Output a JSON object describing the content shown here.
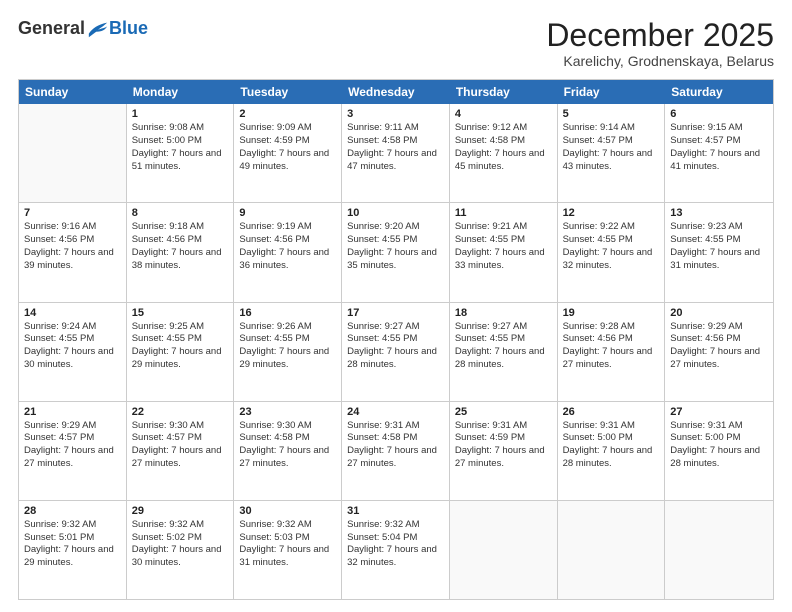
{
  "logo": {
    "general": "General",
    "blue": "Blue"
  },
  "header": {
    "month": "December 2025",
    "location": "Karelichy, Grodnenskaya, Belarus"
  },
  "days_of_week": [
    "Sunday",
    "Monday",
    "Tuesday",
    "Wednesday",
    "Thursday",
    "Friday",
    "Saturday"
  ],
  "weeks": [
    [
      {
        "day": "",
        "empty": true
      },
      {
        "day": "1",
        "sunrise": "Sunrise: 9:08 AM",
        "sunset": "Sunset: 5:00 PM",
        "daylight": "Daylight: 7 hours and 51 minutes."
      },
      {
        "day": "2",
        "sunrise": "Sunrise: 9:09 AM",
        "sunset": "Sunset: 4:59 PM",
        "daylight": "Daylight: 7 hours and 49 minutes."
      },
      {
        "day": "3",
        "sunrise": "Sunrise: 9:11 AM",
        "sunset": "Sunset: 4:58 PM",
        "daylight": "Daylight: 7 hours and 47 minutes."
      },
      {
        "day": "4",
        "sunrise": "Sunrise: 9:12 AM",
        "sunset": "Sunset: 4:58 PM",
        "daylight": "Daylight: 7 hours and 45 minutes."
      },
      {
        "day": "5",
        "sunrise": "Sunrise: 9:14 AM",
        "sunset": "Sunset: 4:57 PM",
        "daylight": "Daylight: 7 hours and 43 minutes."
      },
      {
        "day": "6",
        "sunrise": "Sunrise: 9:15 AM",
        "sunset": "Sunset: 4:57 PM",
        "daylight": "Daylight: 7 hours and 41 minutes."
      }
    ],
    [
      {
        "day": "7",
        "sunrise": "Sunrise: 9:16 AM",
        "sunset": "Sunset: 4:56 PM",
        "daylight": "Daylight: 7 hours and 39 minutes."
      },
      {
        "day": "8",
        "sunrise": "Sunrise: 9:18 AM",
        "sunset": "Sunset: 4:56 PM",
        "daylight": "Daylight: 7 hours and 38 minutes."
      },
      {
        "day": "9",
        "sunrise": "Sunrise: 9:19 AM",
        "sunset": "Sunset: 4:56 PM",
        "daylight": "Daylight: 7 hours and 36 minutes."
      },
      {
        "day": "10",
        "sunrise": "Sunrise: 9:20 AM",
        "sunset": "Sunset: 4:55 PM",
        "daylight": "Daylight: 7 hours and 35 minutes."
      },
      {
        "day": "11",
        "sunrise": "Sunrise: 9:21 AM",
        "sunset": "Sunset: 4:55 PM",
        "daylight": "Daylight: 7 hours and 33 minutes."
      },
      {
        "day": "12",
        "sunrise": "Sunrise: 9:22 AM",
        "sunset": "Sunset: 4:55 PM",
        "daylight": "Daylight: 7 hours and 32 minutes."
      },
      {
        "day": "13",
        "sunrise": "Sunrise: 9:23 AM",
        "sunset": "Sunset: 4:55 PM",
        "daylight": "Daylight: 7 hours and 31 minutes."
      }
    ],
    [
      {
        "day": "14",
        "sunrise": "Sunrise: 9:24 AM",
        "sunset": "Sunset: 4:55 PM",
        "daylight": "Daylight: 7 hours and 30 minutes."
      },
      {
        "day": "15",
        "sunrise": "Sunrise: 9:25 AM",
        "sunset": "Sunset: 4:55 PM",
        "daylight": "Daylight: 7 hours and 29 minutes."
      },
      {
        "day": "16",
        "sunrise": "Sunrise: 9:26 AM",
        "sunset": "Sunset: 4:55 PM",
        "daylight": "Daylight: 7 hours and 29 minutes."
      },
      {
        "day": "17",
        "sunrise": "Sunrise: 9:27 AM",
        "sunset": "Sunset: 4:55 PM",
        "daylight": "Daylight: 7 hours and 28 minutes."
      },
      {
        "day": "18",
        "sunrise": "Sunrise: 9:27 AM",
        "sunset": "Sunset: 4:55 PM",
        "daylight": "Daylight: 7 hours and 28 minutes."
      },
      {
        "day": "19",
        "sunrise": "Sunrise: 9:28 AM",
        "sunset": "Sunset: 4:56 PM",
        "daylight": "Daylight: 7 hours and 27 minutes."
      },
      {
        "day": "20",
        "sunrise": "Sunrise: 9:29 AM",
        "sunset": "Sunset: 4:56 PM",
        "daylight": "Daylight: 7 hours and 27 minutes."
      }
    ],
    [
      {
        "day": "21",
        "sunrise": "Sunrise: 9:29 AM",
        "sunset": "Sunset: 4:57 PM",
        "daylight": "Daylight: 7 hours and 27 minutes."
      },
      {
        "day": "22",
        "sunrise": "Sunrise: 9:30 AM",
        "sunset": "Sunset: 4:57 PM",
        "daylight": "Daylight: 7 hours and 27 minutes."
      },
      {
        "day": "23",
        "sunrise": "Sunrise: 9:30 AM",
        "sunset": "Sunset: 4:58 PM",
        "daylight": "Daylight: 7 hours and 27 minutes."
      },
      {
        "day": "24",
        "sunrise": "Sunrise: 9:31 AM",
        "sunset": "Sunset: 4:58 PM",
        "daylight": "Daylight: 7 hours and 27 minutes."
      },
      {
        "day": "25",
        "sunrise": "Sunrise: 9:31 AM",
        "sunset": "Sunset: 4:59 PM",
        "daylight": "Daylight: 7 hours and 27 minutes."
      },
      {
        "day": "26",
        "sunrise": "Sunrise: 9:31 AM",
        "sunset": "Sunset: 5:00 PM",
        "daylight": "Daylight: 7 hours and 28 minutes."
      },
      {
        "day": "27",
        "sunrise": "Sunrise: 9:31 AM",
        "sunset": "Sunset: 5:00 PM",
        "daylight": "Daylight: 7 hours and 28 minutes."
      }
    ],
    [
      {
        "day": "28",
        "sunrise": "Sunrise: 9:32 AM",
        "sunset": "Sunset: 5:01 PM",
        "daylight": "Daylight: 7 hours and 29 minutes."
      },
      {
        "day": "29",
        "sunrise": "Sunrise: 9:32 AM",
        "sunset": "Sunset: 5:02 PM",
        "daylight": "Daylight: 7 hours and 30 minutes."
      },
      {
        "day": "30",
        "sunrise": "Sunrise: 9:32 AM",
        "sunset": "Sunset: 5:03 PM",
        "daylight": "Daylight: 7 hours and 31 minutes."
      },
      {
        "day": "31",
        "sunrise": "Sunrise: 9:32 AM",
        "sunset": "Sunset: 5:04 PM",
        "daylight": "Daylight: 7 hours and 32 minutes."
      },
      {
        "day": "",
        "empty": true
      },
      {
        "day": "",
        "empty": true
      },
      {
        "day": "",
        "empty": true
      }
    ]
  ]
}
